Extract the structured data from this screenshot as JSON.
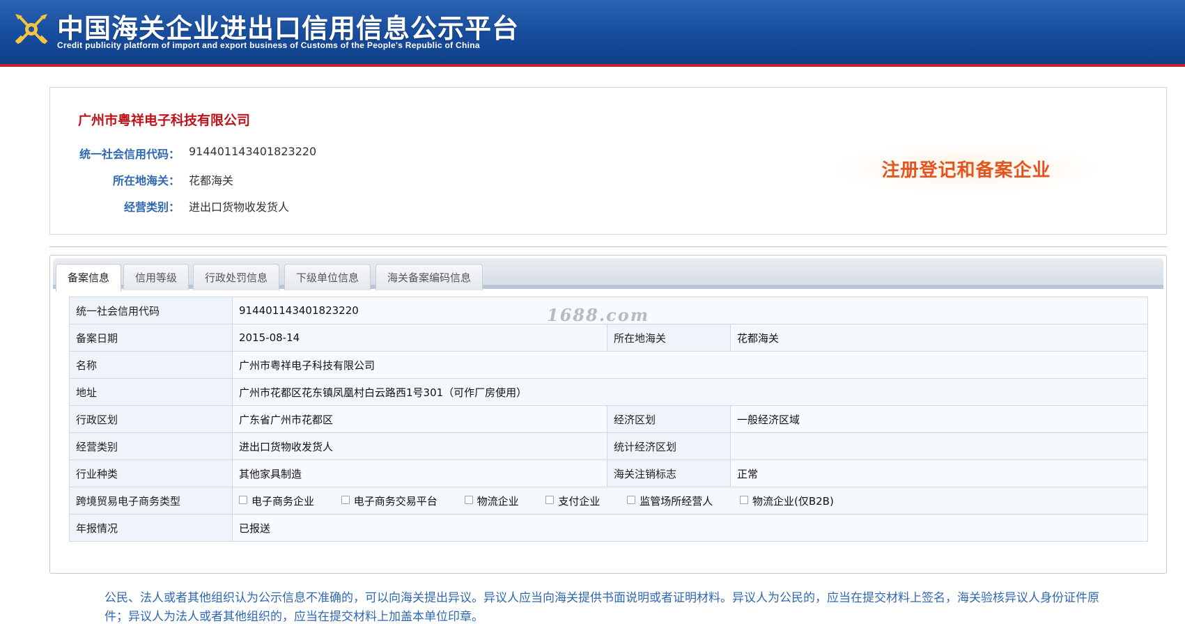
{
  "header": {
    "title": "中国海关企业进出口信用信息公示平台",
    "subtitle": "Credit publicity platform of import and export business of Customs of the People's Republic of China"
  },
  "company": {
    "name": "广州市粤祥电子科技有限公司",
    "fields": [
      {
        "label": "统一社会信用代码：",
        "value": "914401143401823220"
      },
      {
        "label": "所在地海关：",
        "value": "花都海关"
      },
      {
        "label": "经营类别：",
        "value": "进出口货物收发货人"
      }
    ],
    "badge": "注册登记和备案企业"
  },
  "tabs": [
    {
      "label": "备案信息",
      "active": true
    },
    {
      "label": "信用等级",
      "active": false
    },
    {
      "label": "行政处罚信息",
      "active": false
    },
    {
      "label": "下级单位信息",
      "active": false
    },
    {
      "label": "海关备案编码信息",
      "active": false
    }
  ],
  "watermark": "1688.com",
  "record": {
    "credit_code_label": "统一社会信用代码",
    "credit_code": "914401143401823220",
    "record_date_label": "备案日期",
    "record_date": "2015-08-14",
    "customs_label": "所在地海关",
    "customs": "花都海关",
    "name_label": "名称",
    "name": "广州市粤祥电子科技有限公司",
    "address_label": "地址",
    "address": "广州市花都区花东镇凤凰村白云路西1号301（可作厂房使用）",
    "admin_region_label": "行政区划",
    "admin_region": "广东省广州市花都区",
    "econ_zone_label": "经济区划",
    "econ_zone": "一般经济区域",
    "biz_type_label": "经营类别",
    "biz_type": "进出口货物收发货人",
    "stat_zone_label": "统计经济区划",
    "stat_zone": "",
    "industry_label": "行业种类",
    "industry": "其他家具制造",
    "cancel_flag_label": "海关注销标志",
    "cancel_flag": "正常",
    "ecommerce_label": "跨境贸易电子商务类型",
    "ecommerce_options": [
      "电子商务企业",
      "电子商务交易平台",
      "物流企业",
      "支付企业",
      "监管场所经营人",
      "物流企业(仅B2B)"
    ],
    "annual_report_label": "年报情况",
    "annual_report": "已报送"
  },
  "notice": "公民、法人或者其他组织认为公示信息不准确的，可以向海关提出异议。异议人应当向海关提供书面说明或者证明材料。异议人为公民的，应当在提交材料上签名，海关验核异议人身份证件原件；异议人为法人或者其他组织的，应当在提交材料上加盖本单位印章。"
}
